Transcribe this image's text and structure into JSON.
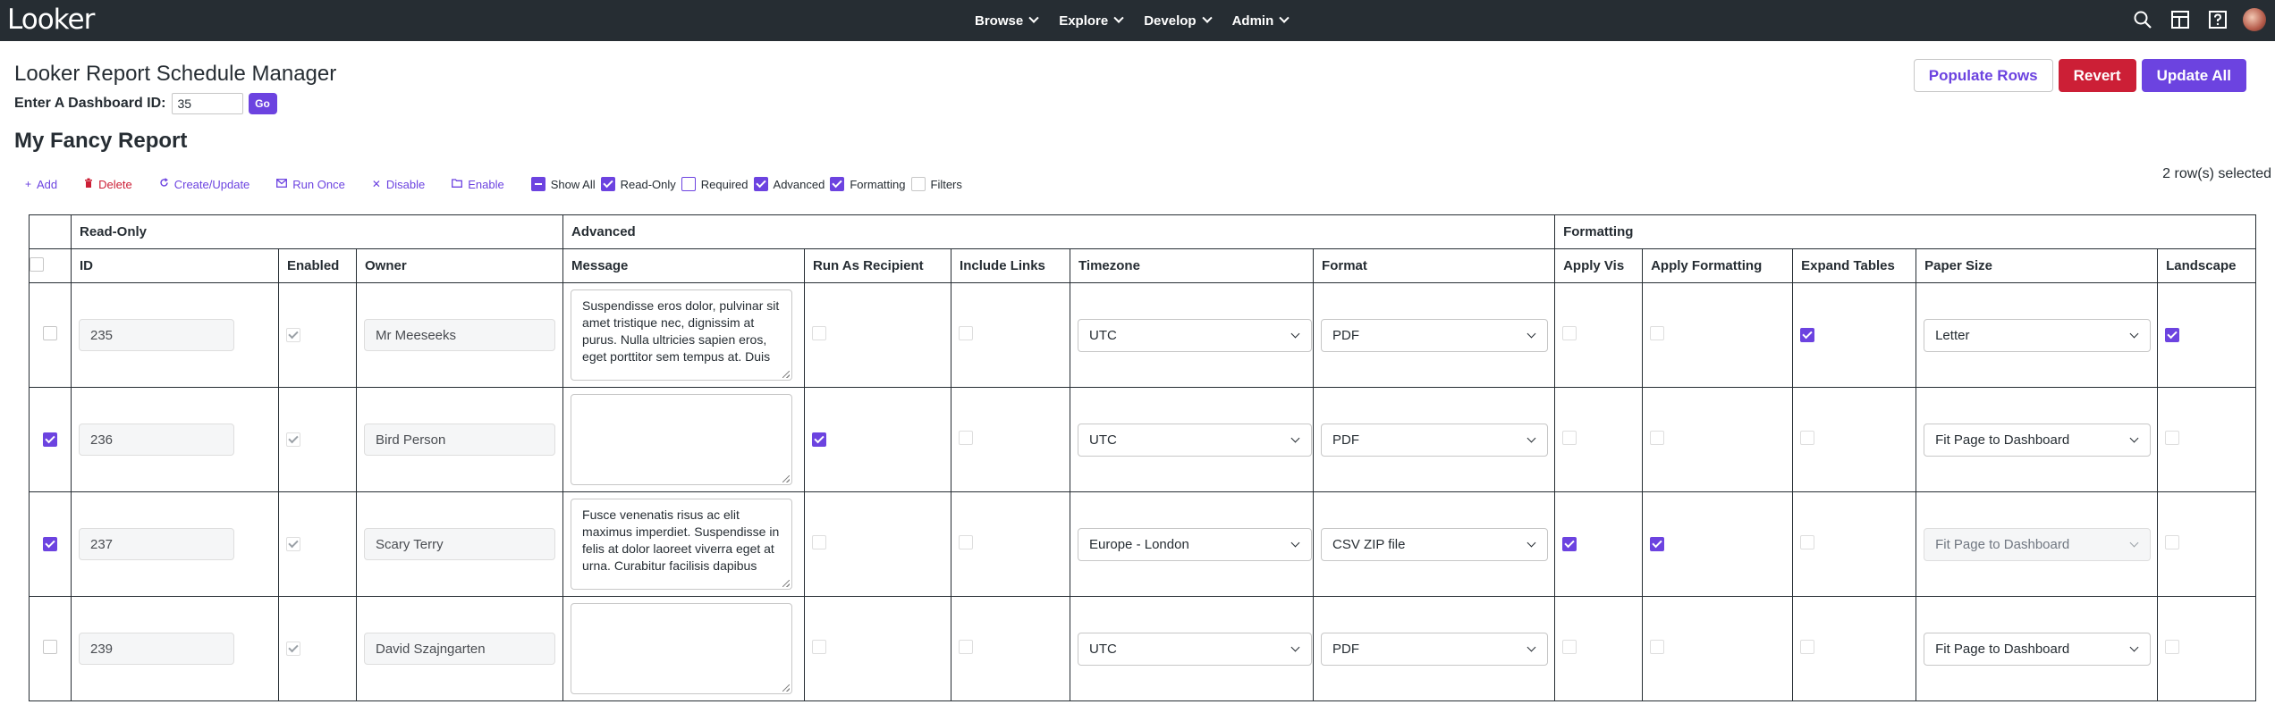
{
  "nav": {
    "logo": "Looker",
    "menu": [
      {
        "label": "Browse"
      },
      {
        "label": "Explore"
      },
      {
        "label": "Develop"
      },
      {
        "label": "Admin"
      }
    ],
    "icons": [
      "search-icon",
      "browse-icon",
      "help-icon",
      "avatar"
    ]
  },
  "header": {
    "title": "Looker Report Schedule Manager",
    "dashboard_label": "Enter A Dashboard ID:",
    "dashboard_value": "35",
    "go_label": "Go",
    "report_title": "My Fancy Report",
    "populate_label": "Populate Rows",
    "revert_label": "Revert",
    "update_label": "Update All",
    "rows_selected": "2 row(s) selected"
  },
  "toolbar": {
    "add": "Add",
    "delete": "Delete",
    "create_update": "Create/Update",
    "run_once": "Run Once",
    "disable": "Disable",
    "enable": "Enable",
    "show_all": "Show All",
    "read_only": "Read-Only",
    "required": "Required",
    "advanced": "Advanced",
    "formatting": "Formatting",
    "filters": "Filters"
  },
  "table": {
    "groups": {
      "read_only": "Read-Only",
      "advanced": "Advanced",
      "formatting": "Formatting"
    },
    "columns": {
      "id": "ID",
      "enabled": "Enabled",
      "owner": "Owner",
      "message": "Message",
      "run_as_recipient": "Run As Recipient",
      "include_links": "Include Links",
      "timezone": "Timezone",
      "format": "Format",
      "apply_vis": "Apply Vis",
      "apply_formatting": "Apply Formatting",
      "expand_tables": "Expand Tables",
      "paper_size": "Paper Size",
      "landscape": "Landscape"
    },
    "rows": [
      {
        "selected": false,
        "id": "235",
        "enabled": true,
        "owner": "Mr Meeseeks",
        "message": "Suspendisse eros dolor, pulvinar sit amet tristique nec, dignissim at purus. Nulla ultricies sapien eros, eget porttitor sem tempus at. Duis",
        "run_as_recipient": false,
        "include_links": false,
        "timezone": "UTC",
        "format": "PDF",
        "apply_vis": false,
        "apply_formatting": false,
        "expand_tables": true,
        "paper_size": "Letter",
        "paper_disabled": false,
        "landscape": true
      },
      {
        "selected": true,
        "id": "236",
        "enabled": true,
        "owner": "Bird Person",
        "message": "",
        "run_as_recipient": true,
        "include_links": false,
        "timezone": "UTC",
        "format": "PDF",
        "apply_vis": false,
        "apply_formatting": false,
        "expand_tables": false,
        "paper_size": "Fit Page to Dashboard",
        "paper_disabled": false,
        "landscape": false
      },
      {
        "selected": true,
        "id": "237",
        "enabled": true,
        "owner": "Scary Terry",
        "message": "Fusce venenatis risus ac elit maximus imperdiet. Suspendisse in felis at dolor laoreet viverra eget at urna. Curabitur facilisis dapibus",
        "run_as_recipient": false,
        "include_links": false,
        "timezone": "Europe - London",
        "format": "CSV ZIP file",
        "apply_vis": true,
        "apply_formatting": true,
        "expand_tables": false,
        "paper_size": "Fit Page to Dashboard",
        "paper_disabled": true,
        "landscape": false
      },
      {
        "selected": false,
        "id": "239",
        "enabled": true,
        "owner": "David Szajngarten",
        "message": "",
        "run_as_recipient": false,
        "include_links": false,
        "timezone": "UTC",
        "format": "PDF",
        "apply_vis": false,
        "apply_formatting": false,
        "expand_tables": false,
        "paper_size": "Fit Page to Dashboard",
        "paper_disabled": false,
        "landscape": false
      }
    ]
  },
  "colors": {
    "nav_bg": "#262d33",
    "accent": "#6c43e0",
    "danger": "#cc1f36"
  }
}
